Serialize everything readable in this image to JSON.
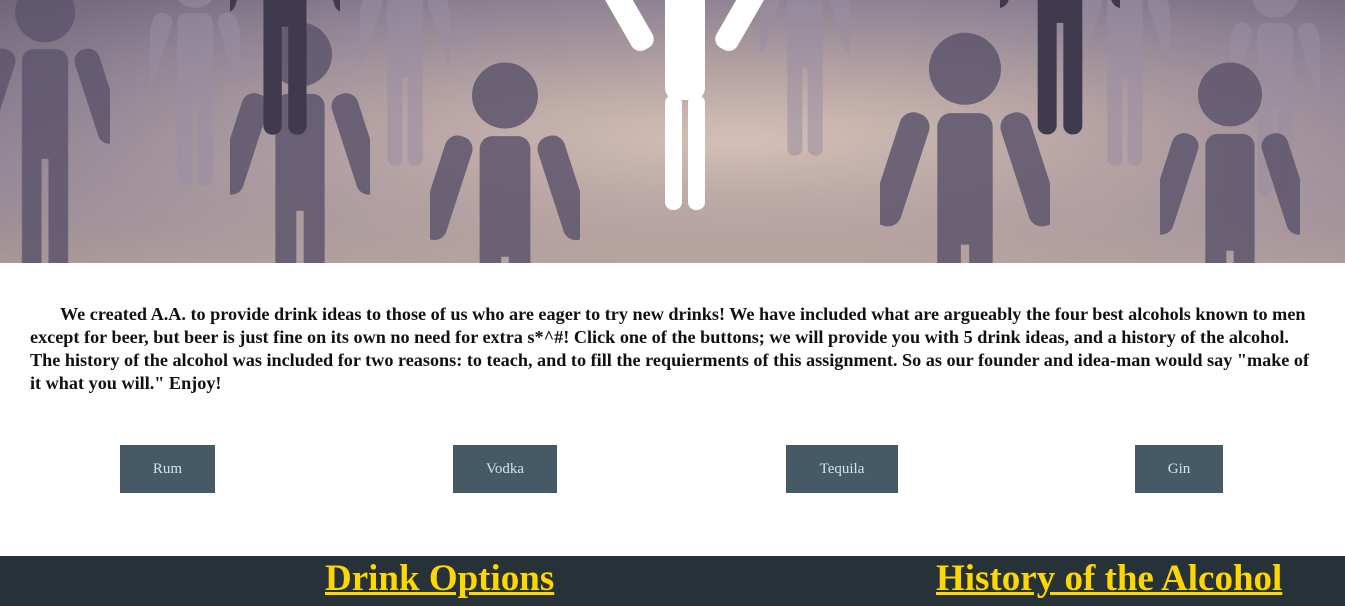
{
  "hero": {
    "image": "crowd-of-figures-illustration"
  },
  "intro": {
    "text": "We created A.A. to provide drink ideas to those of us who are eager to try new drinks! We have included what are argueably the four best alcohols known to men except for beer, but beer is just fine on its own no need for extra s*^#! Click one of the buttons; we will provide you with 5 drink ideas, and a history of the alcohol. The history of the alcohol was included for two reasons: to teach, and to fill the requierments of this assignment. So as our founder and idea-man would say \"make of it what you will.\" Enjoy!"
  },
  "buttons": {
    "rum": "Rum",
    "vodka": "Vodka",
    "tequila": "Tequila",
    "gin": "Gin"
  },
  "footer": {
    "drink_options": "Drink Options",
    "history": "History of the Alcohol"
  },
  "colors": {
    "button_bg": "#455a64",
    "button_text": "#c8e6f5",
    "footer_bg": "#263238",
    "footer_link": "#ffd600"
  }
}
